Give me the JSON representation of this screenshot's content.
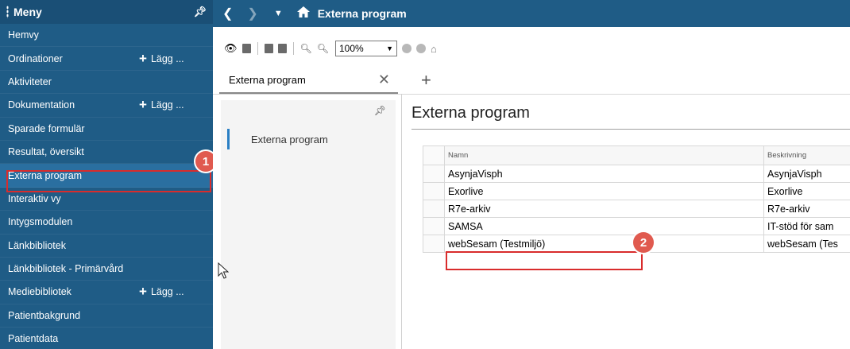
{
  "sidebar": {
    "title": "Meny",
    "items": [
      {
        "label": "Hemvy",
        "add": ""
      },
      {
        "label": "Ordinationer",
        "add": "Lägg ..."
      },
      {
        "label": "Aktiviteter",
        "add": ""
      },
      {
        "label": "Dokumentation",
        "add": "Lägg ..."
      },
      {
        "label": "Sparade formulär",
        "add": ""
      },
      {
        "label": "Resultat, översikt",
        "add": ""
      },
      {
        "label": "Externa program",
        "add": ""
      },
      {
        "label": "Interaktiv vy",
        "add": ""
      },
      {
        "label": "Intygsmodulen",
        "add": ""
      },
      {
        "label": "Länkbibliotek",
        "add": ""
      },
      {
        "label": "Länkbibliotek - Primärvård",
        "add": ""
      },
      {
        "label": "Mediebibliotek",
        "add": "Lägg ..."
      },
      {
        "label": "Patientbakgrund",
        "add": ""
      },
      {
        "label": "Patientdata",
        "add": ""
      }
    ],
    "active_index": 6
  },
  "topbar": {
    "title": "Externa program"
  },
  "toolbar": {
    "zoom": "100%"
  },
  "tab": {
    "label": "Externa program"
  },
  "inner_panel": {
    "item": "Externa program"
  },
  "main": {
    "title": "Externa program",
    "columns": [
      "Namn",
      "Beskrivning"
    ],
    "rows": [
      {
        "name": "AsynjaVisph",
        "desc": "AsynjaVisph"
      },
      {
        "name": "Exorlive",
        "desc": "Exorlive"
      },
      {
        "name": "R7e-arkiv",
        "desc": "R7e-arkiv"
      },
      {
        "name": "SAMSA",
        "desc": "IT-stöd för sam"
      },
      {
        "name": "webSesam (Testmiljö)",
        "desc": "webSesam (Tes"
      }
    ]
  },
  "annotations": {
    "badge1": "1",
    "badge2": "2"
  }
}
